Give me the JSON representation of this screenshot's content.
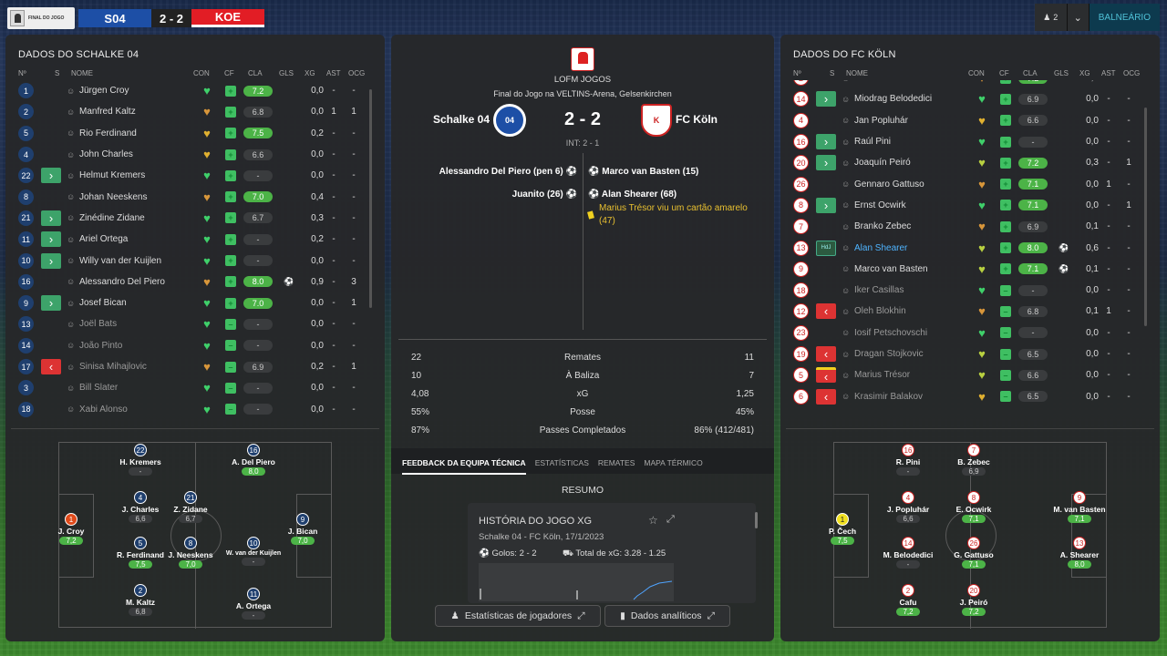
{
  "header": {
    "competition": "FINAL DO JOGO",
    "home_short": "S04",
    "score": "2 - 2",
    "away_short": "KOE",
    "players_count": "2",
    "locker": "BALNEÁRIO"
  },
  "columns": {
    "no": "Nº",
    "s": "S",
    "name": "NOME",
    "con": "CON",
    "cf": "CF",
    "cla": "CLA",
    "gls": "GLS",
    "xg": "XG",
    "ast": "AST",
    "ocg": "OCG"
  },
  "home": {
    "title": "DADOS DO SCHALKE 04",
    "players": [
      {
        "num": "1",
        "sub": "none",
        "name": "Jürgen Croy",
        "heart": "#3fd06a",
        "cla": "7.2",
        "good": true,
        "gls": "",
        "xg": "0,0",
        "ast": "-",
        "ocg": "-",
        "dim": false
      },
      {
        "num": "2",
        "sub": "none",
        "name": "Manfred Kaltz",
        "heart": "#d8963a",
        "cla": "6.8",
        "good": false,
        "gls": "",
        "xg": "0,0",
        "ast": "1",
        "ocg": "1",
        "dim": false
      },
      {
        "num": "5",
        "sub": "none",
        "name": "Rio Ferdinand",
        "heart": "#e0b030",
        "cla": "7.5",
        "good": true,
        "gls": "",
        "xg": "0,2",
        "ast": "-",
        "ocg": "-",
        "dim": false
      },
      {
        "num": "4",
        "sub": "none",
        "name": "John Charles",
        "heart": "#e0b030",
        "cla": "6.6",
        "good": false,
        "gls": "",
        "xg": "0,0",
        "ast": "-",
        "ocg": "-",
        "dim": false
      },
      {
        "num": "22",
        "sub": "in",
        "name": "Helmut Kremers",
        "heart": "#3fd06a",
        "cla": "-",
        "good": false,
        "gls": "",
        "xg": "0,0",
        "ast": "-",
        "ocg": "-",
        "dim": false
      },
      {
        "num": "8",
        "sub": "none",
        "name": "Johan Neeskens",
        "heart": "#d8963a",
        "cla": "7.0",
        "good": true,
        "gls": "",
        "xg": "0,4",
        "ast": "-",
        "ocg": "-",
        "dim": false
      },
      {
        "num": "21",
        "sub": "in",
        "name": "Zinédine Zidane",
        "heart": "#3fd06a",
        "cla": "6.7",
        "good": false,
        "gls": "",
        "xg": "0,3",
        "ast": "-",
        "ocg": "-",
        "dim": false
      },
      {
        "num": "11",
        "sub": "in",
        "name": "Ariel Ortega",
        "heart": "#3fd06a",
        "cla": "-",
        "good": false,
        "gls": "",
        "xg": "0,2",
        "ast": "-",
        "ocg": "-",
        "dim": false
      },
      {
        "num": "10",
        "sub": "in",
        "name": "Willy van der Kuijlen",
        "heart": "#3fd06a",
        "cla": "-",
        "good": false,
        "gls": "",
        "xg": "0,0",
        "ast": "-",
        "ocg": "-",
        "dim": false
      },
      {
        "num": "16",
        "sub": "none",
        "name": "Alessandro Del Piero",
        "heart": "#d8963a",
        "cla": "8.0",
        "good": true,
        "gls": "⚽",
        "xg": "0,9",
        "ast": "-",
        "ocg": "3",
        "dim": false
      },
      {
        "num": "9",
        "sub": "in",
        "name": "Josef Bican",
        "heart": "#3fd06a",
        "cla": "7.0",
        "good": true,
        "gls": "",
        "xg": "0,0",
        "ast": "-",
        "ocg": "1",
        "dim": false
      },
      {
        "num": "13",
        "sub": "none",
        "name": "Joël Bats",
        "heart": "#3fd06a",
        "cla": "-",
        "good": false,
        "gls": "",
        "xg": "0,0",
        "ast": "-",
        "ocg": "-",
        "dim": true
      },
      {
        "num": "14",
        "sub": "none",
        "name": "João Pinto",
        "heart": "#3fd06a",
        "cla": "-",
        "good": false,
        "gls": "",
        "xg": "0,0",
        "ast": "-",
        "ocg": "-",
        "dim": true
      },
      {
        "num": "17",
        "sub": "out",
        "name": "Sinisa Mihajlovic",
        "heart": "#d8963a",
        "cla": "6.9",
        "good": false,
        "gls": "",
        "xg": "0,2",
        "ast": "-",
        "ocg": "1",
        "dim": true
      },
      {
        "num": "3",
        "sub": "none",
        "name": "Bill Slater",
        "heart": "#3fd06a",
        "cla": "-",
        "good": false,
        "gls": "",
        "xg": "0,0",
        "ast": "-",
        "ocg": "-",
        "dim": true
      },
      {
        "num": "18",
        "sub": "none",
        "name": "Xabi Alonso",
        "heart": "#3fd06a",
        "cla": "-",
        "good": false,
        "gls": "",
        "xg": "0,0",
        "ast": "-",
        "ocg": "-",
        "dim": true
      }
    ],
    "pitch": [
      {
        "num": "1",
        "label": "J. Croy",
        "rating": "7,2",
        "good": true,
        "gk": true
      },
      {
        "num": "22",
        "label": "H. Kremers",
        "rating": "-",
        "good": false
      },
      {
        "num": "4",
        "label": "J. Charles",
        "rating": "6,6",
        "good": false
      },
      {
        "num": "5",
        "label": "R. Ferdinand",
        "rating": "7,5",
        "good": true
      },
      {
        "num": "2",
        "label": "M. Kaltz",
        "rating": "6,8",
        "good": false
      },
      {
        "num": "21",
        "label": "Z. Zidane",
        "rating": "6,7",
        "good": false
      },
      {
        "num": "8",
        "label": "J. Neeskens",
        "rating": "7,0",
        "good": true
      },
      {
        "num": "16",
        "label": "A. Del Piero",
        "rating": "8,0",
        "good": true
      },
      {
        "num": "10",
        "label": "W. van der Kuijlen",
        "rating": "-",
        "good": false
      },
      {
        "num": "11",
        "label": "A. Ortega",
        "rating": "-",
        "good": false
      },
      {
        "num": "9",
        "label": "J. Bican",
        "rating": "7,0",
        "good": true
      }
    ]
  },
  "away": {
    "title": "DADOS DO FC KÖLN",
    "players": [
      {
        "num": "2",
        "sub": "none",
        "name": "Cafu",
        "heart": "#d8963a",
        "cla": "7.2",
        "good": true,
        "gls": "",
        "xg": "0,0",
        "ast": "-",
        "ocg": "1",
        "dim": false
      },
      {
        "num": "14",
        "sub": "in",
        "name": "Miodrag Belodedici",
        "heart": "#3fd06a",
        "cla": "6.9",
        "good": false,
        "gls": "",
        "xg": "0,0",
        "ast": "-",
        "ocg": "-",
        "dim": false
      },
      {
        "num": "4",
        "sub": "none",
        "name": "Jan Popluhár",
        "heart": "#e0b030",
        "cla": "6.6",
        "good": false,
        "gls": "",
        "xg": "0,0",
        "ast": "-",
        "ocg": "-",
        "dim": false
      },
      {
        "num": "16",
        "sub": "in",
        "name": "Raúl Pini",
        "heart": "#3fd06a",
        "cla": "-",
        "good": false,
        "gls": "",
        "xg": "0,0",
        "ast": "-",
        "ocg": "-",
        "dim": false
      },
      {
        "num": "20",
        "sub": "in",
        "name": "Joaquín Peiró",
        "heart": "#b8d040",
        "cla": "7.2",
        "good": true,
        "gls": "",
        "xg": "0,3",
        "ast": "-",
        "ocg": "1",
        "dim": false
      },
      {
        "num": "26",
        "sub": "none",
        "name": "Gennaro Gattuso",
        "heart": "#d8963a",
        "cla": "7.1",
        "good": true,
        "gls": "",
        "xg": "0,0",
        "ast": "1",
        "ocg": "-",
        "dim": false
      },
      {
        "num": "8",
        "sub": "in",
        "name": "Ernst Ocwirk",
        "heart": "#3fd06a",
        "cla": "7.1",
        "good": true,
        "gls": "",
        "xg": "0,0",
        "ast": "-",
        "ocg": "1",
        "dim": false
      },
      {
        "num": "7",
        "sub": "none",
        "name": "Branko Zebec",
        "heart": "#d8963a",
        "cla": "6.9",
        "good": false,
        "gls": "",
        "xg": "0,1",
        "ast": "-",
        "ocg": "-",
        "dim": false
      },
      {
        "num": "13",
        "sub": "hdj",
        "name": "Alan Shearer",
        "heart": "#b8d040",
        "cla": "8.0",
        "good": true,
        "gls": "⚽",
        "xg": "0,6",
        "ast": "-",
        "ocg": "-",
        "dim": false,
        "hl": true
      },
      {
        "num": "9",
        "sub": "none",
        "name": "Marco van Basten",
        "heart": "#b8d040",
        "cla": "7.1",
        "good": true,
        "gls": "⚽",
        "xg": "0,1",
        "ast": "-",
        "ocg": "-",
        "dim": false
      },
      {
        "num": "18",
        "sub": "none",
        "name": "Iker Casillas",
        "heart": "#3fd06a",
        "cla": "-",
        "good": false,
        "gls": "",
        "xg": "0,0",
        "ast": "-",
        "ocg": "-",
        "dim": true
      },
      {
        "num": "12",
        "sub": "out",
        "name": "Oleh Blokhin",
        "heart": "#d8963a",
        "cla": "6.8",
        "good": false,
        "gls": "",
        "xg": "0,1",
        "ast": "1",
        "ocg": "-",
        "dim": true
      },
      {
        "num": "23",
        "sub": "none",
        "name": "Iosif Petschovschi",
        "heart": "#3fd06a",
        "cla": "-",
        "good": false,
        "gls": "",
        "xg": "0,0",
        "ast": "-",
        "ocg": "-",
        "dim": true
      },
      {
        "num": "19",
        "sub": "out",
        "name": "Dragan Stojkovic",
        "heart": "#b8d040",
        "cla": "6.5",
        "good": false,
        "gls": "",
        "xg": "0,0",
        "ast": "-",
        "ocg": "-",
        "dim": true
      },
      {
        "num": "5",
        "sub": "outy",
        "name": "Marius Trésor",
        "heart": "#b8d040",
        "cla": "6.6",
        "good": false,
        "gls": "",
        "xg": "0,0",
        "ast": "-",
        "ocg": "-",
        "dim": true
      },
      {
        "num": "6",
        "sub": "out",
        "name": "Krasimir Balakov",
        "heart": "#e0b030",
        "cla": "6.5",
        "good": false,
        "gls": "",
        "xg": "0,0",
        "ast": "-",
        "ocg": "-",
        "dim": true
      }
    ],
    "pitch": [
      {
        "num": "1",
        "label": "P. Čech",
        "rating": "7,5",
        "good": true,
        "gk": true
      },
      {
        "num": "16",
        "label": "R. Pini",
        "rating": "-",
        "good": false
      },
      {
        "num": "4",
        "label": "J. Popluhár",
        "rating": "6,6",
        "good": false
      },
      {
        "num": "14",
        "label": "M. Belodedici",
        "rating": "-",
        "good": false
      },
      {
        "num": "2",
        "label": "Cafu",
        "rating": "7,2",
        "good": true
      },
      {
        "num": "7",
        "label": "B. Zebec",
        "rating": "6,9",
        "good": false
      },
      {
        "num": "8",
        "label": "E. Ocwirk",
        "rating": "7,1",
        "good": true
      },
      {
        "num": "26",
        "label": "G. Gattuso",
        "rating": "7,1",
        "good": true
      },
      {
        "num": "20",
        "label": "J. Peiró",
        "rating": "7,2",
        "good": true
      },
      {
        "num": "9",
        "label": "M. van Basten",
        "rating": "7,1",
        "good": true
      },
      {
        "num": "13",
        "label": "A. Shearer",
        "rating": "8,0",
        "good": true
      }
    ]
  },
  "match": {
    "competition": "LOFM JOGOS",
    "subtitle": "Final do Jogo na VELTINS-Arena, Gelsenkirchen",
    "home": "Schalke 04",
    "away": "FC Köln",
    "score": "2 - 2",
    "interval": "INT: 2 - 1",
    "home_events": [
      "Alessandro Del Piero (pen 6)",
      "Juanito (26)"
    ],
    "away_events": [
      "Marco van Basten (15)",
      "Alan Shearer (68)"
    ],
    "card_event": "Marius Trésor viu um cartão amarelo (47)"
  },
  "stats": [
    {
      "home": "22",
      "label": "Remates",
      "away": "11"
    },
    {
      "home": "10",
      "label": "À Baliza",
      "away": "7"
    },
    {
      "home": "4,08",
      "label": "xG",
      "away": "1,25"
    },
    {
      "home": "55%",
      "label": "Posse",
      "away": "45%"
    },
    {
      "home": "87%",
      "label": "Passes Completados",
      "away": "86% (412/481)"
    }
  ],
  "tabs": [
    "FEEDBACK DA EQUIPA TÉCNICA",
    "ESTATÍSTICAS",
    "REMATES",
    "MAPA TÉRMICO"
  ],
  "summary": {
    "title": "RESUMO",
    "card_title": "HISTÓRIA DO JOGO XG",
    "card_sub": "Schalke 04 - FC Köln, 17/1/2023",
    "goals": "Golos: 2 - 2",
    "xg_total": "Total de xG: 3.28 - 1.25"
  },
  "buttons": {
    "player_stats": "Estatísticas de jogadores",
    "analytics": "Dados analíticos"
  }
}
